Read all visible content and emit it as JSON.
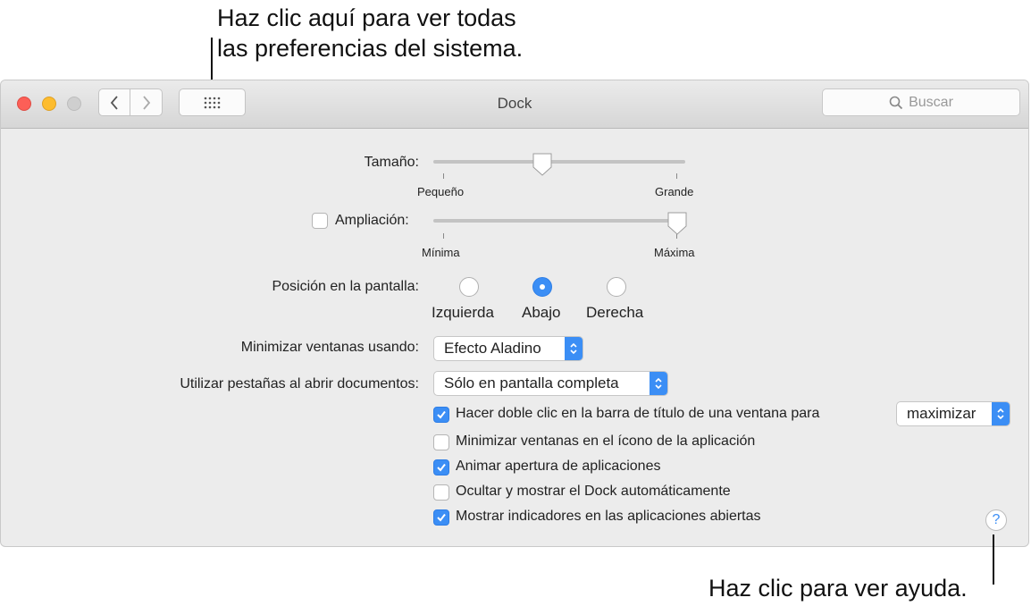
{
  "callouts": {
    "top_line1": "Haz clic aquí para ver todas",
    "top_line2": "las preferencias del sistema.",
    "bottom": "Haz clic para ver ayuda."
  },
  "window": {
    "title": "Dock",
    "search_placeholder": "Buscar"
  },
  "size": {
    "label": "Tamaño:",
    "min_label": "Pequeño",
    "max_label": "Grande",
    "value_fraction": 0.43
  },
  "magnification": {
    "label": "Ampliación:",
    "enabled": false,
    "min_label": "Mínima",
    "max_label": "Máxima",
    "value_fraction": 0.98
  },
  "position": {
    "label": "Posición en la pantalla:",
    "options": [
      "Izquierda",
      "Abajo",
      "Derecha"
    ],
    "selected": "Abajo"
  },
  "minimize": {
    "label": "Minimizar ventanas usando:",
    "value": "Efecto Aladino"
  },
  "tabs": {
    "label": "Utilizar pestañas al abrir documentos:",
    "value": "Sólo en pantalla completa"
  },
  "checkboxes": [
    {
      "label": "Hacer doble clic en la barra de título de una ventana para",
      "checked": true
    },
    {
      "label": "Minimizar ventanas en el ícono de la aplicación",
      "checked": false
    },
    {
      "label": "Animar apertura de aplicaciones",
      "checked": true
    },
    {
      "label": "Ocultar y mostrar el Dock automáticamente",
      "checked": false
    },
    {
      "label": "Mostrar indicadores en las aplicaciones abiertas",
      "checked": true
    }
  ],
  "double_click_action": "maximizar",
  "help_glyph": "?",
  "colors": {
    "accent": "#3b8ef5",
    "close": "#fc5f57",
    "minimize": "#fdbc2e",
    "zoom_disabled": "#cfcfcf"
  }
}
